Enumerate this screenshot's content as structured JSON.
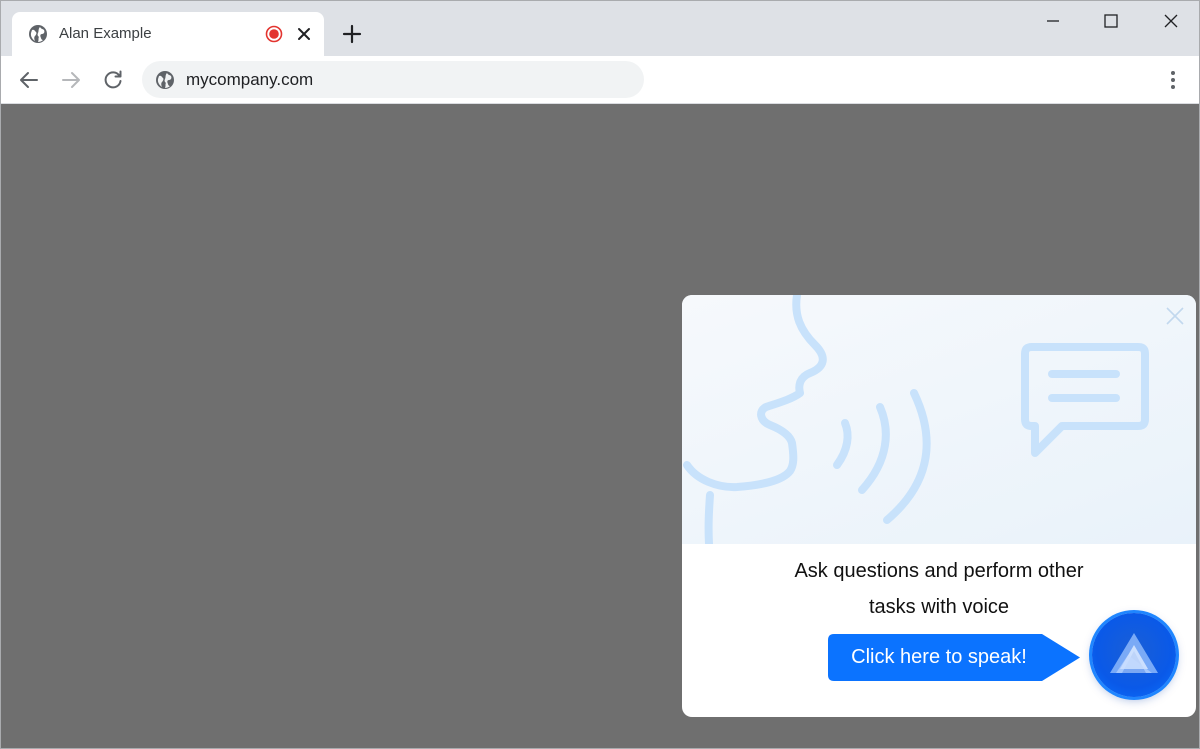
{
  "browser": {
    "tab": {
      "title": "Alan Example"
    },
    "address": {
      "url": "mycompany.com"
    }
  },
  "popup": {
    "message_line1": "Ask questions and perform other",
    "message_line2": "tasks with voice",
    "cta_label": "Click here to speak!"
  },
  "colors": {
    "accent": "#0b73ff",
    "illustration": "#c8e2fb",
    "record": "#e3342f"
  }
}
